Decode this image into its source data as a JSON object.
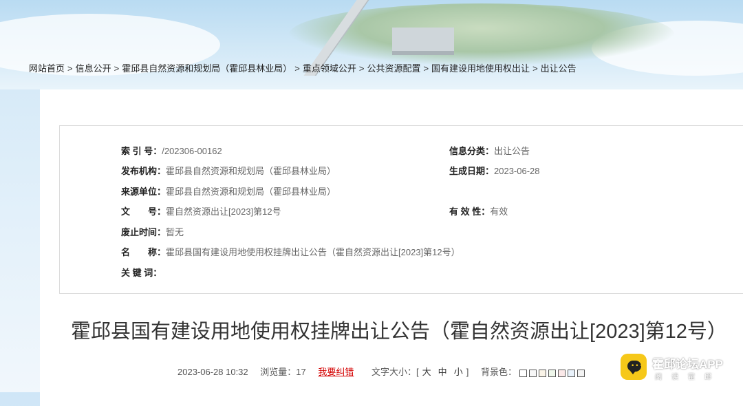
{
  "breadcrumb": {
    "items": [
      "网站首页",
      "信息公开",
      "霍邱县自然资源和规划局（霍邱县林业局）",
      "重点领域公开",
      "公共资源配置",
      "国有建设用地使用权出让",
      "出让公告"
    ],
    "separator": ">"
  },
  "info": {
    "index_label": "索 引 号：",
    "index_value": "/202306-00162",
    "category_label": "信息分类：",
    "category_value": "出让公告",
    "publisher_label": "发布机构：",
    "publisher_value": "霍邱县自然资源和规划局（霍邱县林业局）",
    "date_label": "生成日期：",
    "date_value": "2023-06-28",
    "source_label": "来源单位：",
    "source_value": "霍邱县自然资源和规划局（霍邱县林业局）",
    "docno_label": "文　　号：",
    "docno_value": "霍自然资源出让[2023]第12号",
    "validity_label": "有 效 性：",
    "validity_value": "有效",
    "expire_label": "废止时间：",
    "expire_value": "暂无",
    "name_label": "名　　称：",
    "name_value": "霍邱县国有建设用地使用权挂牌出让公告（霍自然资源出让[2023]第12号）",
    "keywords_label": "关 键 词：",
    "keywords_value": ""
  },
  "article": {
    "title": "霍邱县国有建设用地使用权挂牌出让公告（霍自然资源出让[2023]第12号）",
    "datetime": "2023-06-28 10:32",
    "views_label": "浏览量：",
    "views_value": "17",
    "correct_label": "我要纠错",
    "fontsize_label": "文字大小：[",
    "fontsize_large": "大",
    "fontsize_medium": "中",
    "fontsize_small": "小",
    "fontsize_close": "]",
    "bg_label": "背景色："
  },
  "background_colors": [
    "#ffffff",
    "#f7f7f7",
    "#faf4e8",
    "#eef6ea",
    "#fbe9e9",
    "#e9f2fb",
    "#f3f3f3"
  ],
  "watermark": {
    "app_name": "霍邱论坛APP",
    "app_sub": "阅读霍邱",
    "icon": "chat-bubble-icon",
    "accent": "#f6c819"
  }
}
